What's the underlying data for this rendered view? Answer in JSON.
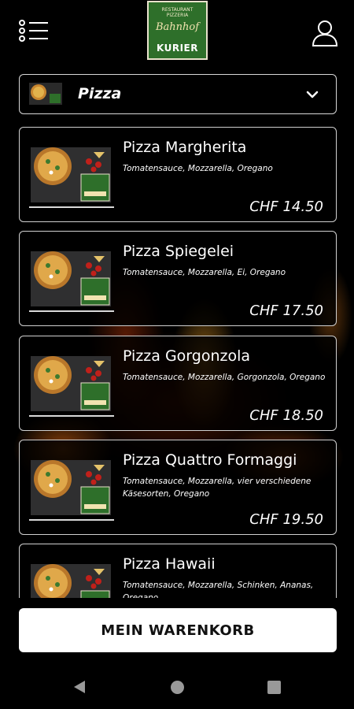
{
  "header": {
    "logo": {
      "top_text": "RESTAURANT PIZZERIA",
      "script_text": "Bahnhof",
      "main_text": "KURIER"
    }
  },
  "category": {
    "label": "Pizza"
  },
  "menu_items": [
    {
      "name": "Pizza Margherita",
      "description": "Tomatensauce, Mozzarella, Oregano",
      "price": "CHF 14.50"
    },
    {
      "name": "Pizza Spiegelei",
      "description": "Tomatensauce, Mozzarella, Ei, Oregano",
      "price": "CHF 17.50"
    },
    {
      "name": "Pizza Gorgonzola",
      "description": "Tomatensauce, Mozzarella, Gorgonzola, Oregano",
      "price": "CHF 18.50"
    },
    {
      "name": "Pizza Quattro Formaggi",
      "description": "Tomatensauce, Mozzarella, vier verschiedene Käsesorten, Oregano",
      "price": "CHF 19.50"
    },
    {
      "name": "Pizza Hawaii",
      "description": "Tomatensauce, Mozzarella, Schinken, Ananas, Oregano",
      "price": ""
    }
  ],
  "cart": {
    "label": "MEIN WARENKORB"
  },
  "colors": {
    "background": "#000000",
    "logo_green": "#2e6f2a",
    "card_border": "#d0d0d0",
    "button_bg": "#ffffff"
  },
  "icons": [
    "menu-icon",
    "user-icon",
    "chevron-down-icon",
    "nav-back-icon",
    "nav-home-icon",
    "nav-recent-icon"
  ]
}
